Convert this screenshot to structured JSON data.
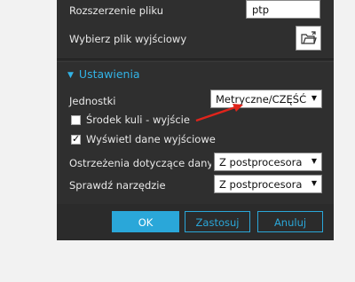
{
  "output": {
    "file_extension_label": "Rozszerzenie pliku",
    "file_extension_value": "ptp",
    "select_output_file_label": "Wybierz plik wyjściowy",
    "folder_icon": "folder-open-icon"
  },
  "settings": {
    "header": "Ustawienia",
    "units_label": "Jednostki",
    "units_value": "Metryczne/CZĘŚĆ",
    "ball_center_label": "Środek kuli - wyjście",
    "ball_center_checked": false,
    "show_output_label": "Wyświetl dane wyjściowe",
    "show_output_checked": true,
    "warnings_label": "Ostrzeżenia dotyczące danych",
    "warnings_value": "Z postprocesora",
    "check_tool_label": "Sprawdź narzędzie",
    "check_tool_value": "Z postprocesora"
  },
  "buttons": {
    "ok": "OK",
    "apply": "Zastosuj",
    "cancel": "Anuluj"
  },
  "colors": {
    "accent": "#2aa7d9",
    "dialog_bg": "#2b2b2b",
    "annotation_arrow": "#e0241b"
  }
}
